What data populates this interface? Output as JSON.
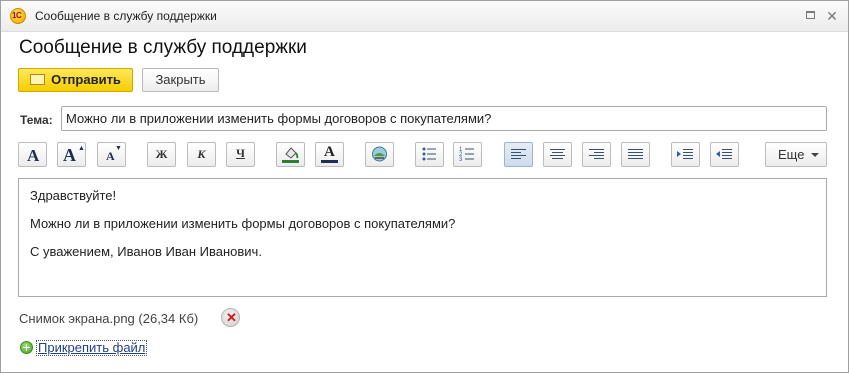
{
  "window": {
    "title": "Сообщение в службу поддержки",
    "app_icon_text": "1С"
  },
  "form": {
    "title": "Сообщение в службу поддержки",
    "send_label": "Отправить",
    "close_label": "Закрыть"
  },
  "subject": {
    "label": "Тема:",
    "value": "Можно ли в приложении изменить формы договоров с покупателями?"
  },
  "toolbar": {
    "bold_glyph": "Ж",
    "italic_glyph": "К",
    "underline_glyph": "Ч",
    "more_label": "Еще",
    "active_alignment": "align-left"
  },
  "message": {
    "lines": [
      "Здравствуйте!",
      "Можно ли в приложении изменить формы договоров с покупателями?",
      "С уважением, Иванов Иван Иванович."
    ]
  },
  "attachment": {
    "file_name": "Снимок экрана.png (26,34 Кб)",
    "add_file_label": "Прикрепить файл"
  },
  "colors": {
    "send_button": "#f5cd00",
    "link": "#1f3f8f",
    "remove_icon": "#dd1111",
    "add_icon": "#41a620"
  }
}
